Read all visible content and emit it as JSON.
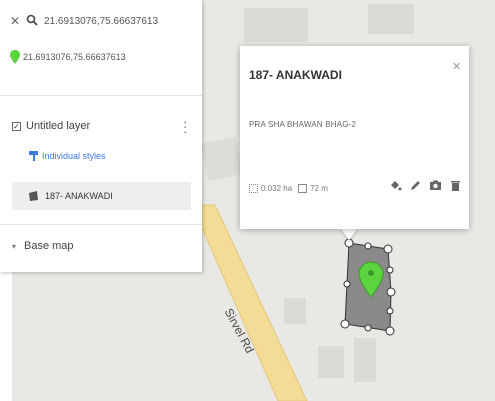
{
  "search": {
    "query": "21.6913076,75.66637613",
    "close_icon": "close-icon",
    "icon": "search-icon"
  },
  "result": {
    "label": "21.6913076,75.66637613",
    "icon": "green-pin-icon"
  },
  "layer": {
    "name": "Untitled layer",
    "checked": true,
    "styles_label": "Individual styles",
    "feature_label": "187- ANAKWADI"
  },
  "base_map": {
    "label": "Base map"
  },
  "popup": {
    "title": "187- ANAKWADI",
    "description": "PRA SHA BHAWAN BHAG-2",
    "area": "0.032 ha",
    "perimeter": "72 m",
    "tools": [
      "paint-bucket-icon",
      "pencil-icon",
      "camera-icon",
      "trash-icon"
    ]
  },
  "map": {
    "road_label": "Sirvel Rd"
  },
  "colors": {
    "accent": "#3b78e7",
    "pin": "#5bd43f",
    "road": "#f3dc96",
    "polygon": "#8a8a8a",
    "map_bg": "#eae8e4"
  }
}
